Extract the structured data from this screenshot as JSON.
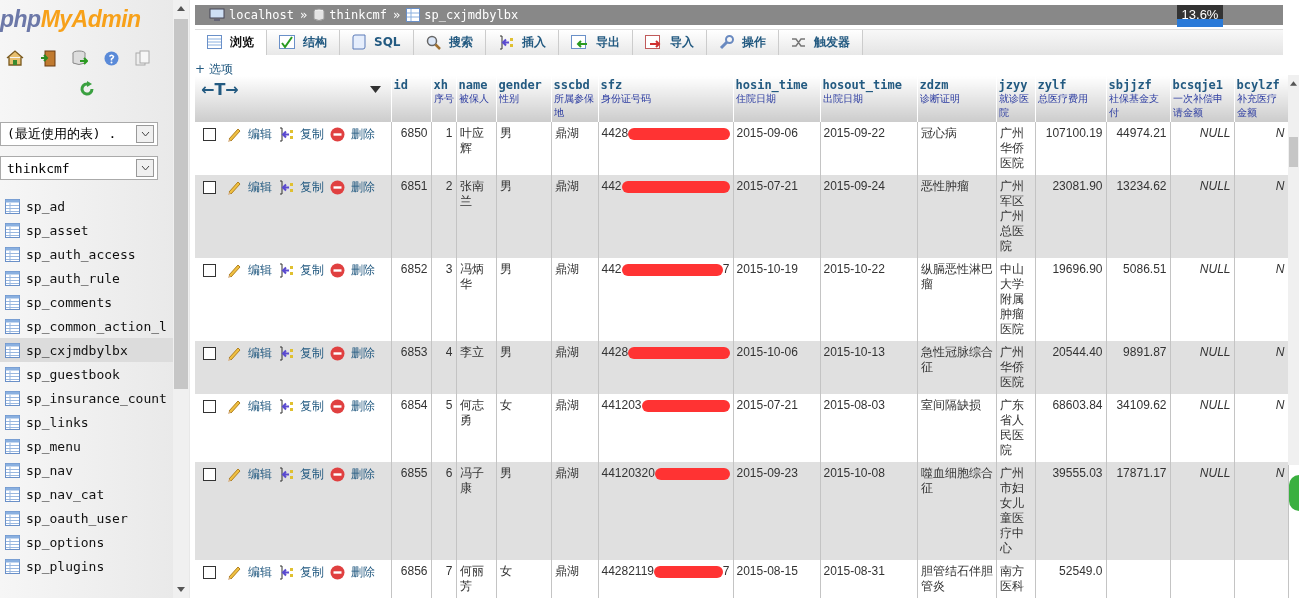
{
  "sidebar": {
    "logo": {
      "part1": "php",
      "part2": "MyAdmin"
    },
    "recent_select": "(最近使用的表) .",
    "db_select": "thinkcmf",
    "tables": [
      {
        "label": "sp_ad",
        "selected": false
      },
      {
        "label": "sp_asset",
        "selected": false
      },
      {
        "label": "sp_auth_access",
        "selected": false
      },
      {
        "label": "sp_auth_rule",
        "selected": false
      },
      {
        "label": "sp_comments",
        "selected": false
      },
      {
        "label": "sp_common_action_l",
        "selected": false
      },
      {
        "label": "sp_cxjmdbylbx",
        "selected": true
      },
      {
        "label": "sp_guestbook",
        "selected": false
      },
      {
        "label": "sp_insurance_count",
        "selected": false
      },
      {
        "label": "sp_links",
        "selected": false
      },
      {
        "label": "sp_menu",
        "selected": false
      },
      {
        "label": "sp_nav",
        "selected": false
      },
      {
        "label": "sp_nav_cat",
        "selected": false
      },
      {
        "label": "sp_oauth_user",
        "selected": false
      },
      {
        "label": "sp_options",
        "selected": false
      },
      {
        "label": "sp_plugins",
        "selected": false
      }
    ]
  },
  "breadcrumb": [
    {
      "kind": "server",
      "label": "localhost"
    },
    {
      "kind": "database",
      "label": "thinkcmf"
    },
    {
      "kind": "table",
      "label": "sp_cxjmdbylbx"
    }
  ],
  "breadcrumb_separator": "»",
  "overlay_badge": "13.6%",
  "tabs": [
    {
      "kind": "browse",
      "label": "浏览",
      "selected": true
    },
    {
      "kind": "structure",
      "label": "结构",
      "selected": false
    },
    {
      "kind": "sql",
      "label": "SQL",
      "selected": false
    },
    {
      "kind": "search",
      "label": "搜索",
      "selected": false
    },
    {
      "kind": "insert",
      "label": "插入",
      "selected": false
    },
    {
      "kind": "export",
      "label": "导出",
      "selected": false
    },
    {
      "kind": "import",
      "label": "导入",
      "selected": false
    },
    {
      "kind": "operations",
      "label": "操作",
      "selected": false
    },
    {
      "kind": "triggers",
      "label": "触发器",
      "selected": false
    }
  ],
  "options_link": "+ 选项",
  "table": {
    "resize_label": "←T→",
    "columns": [
      {
        "name": "id",
        "kind": "num"
      },
      {
        "name": "xh",
        "comment": "序号",
        "kind": "num"
      },
      {
        "name": "name",
        "comment": "被保人",
        "kind": "text"
      },
      {
        "name": "gender",
        "comment": "性别",
        "kind": "text"
      },
      {
        "name": "sscbd",
        "comment": "所属参保地",
        "kind": "text"
      },
      {
        "name": "sfz",
        "comment": "身份证号码",
        "kind": "redacted"
      },
      {
        "name": "hosin_time",
        "comment": "住院日期",
        "kind": "text"
      },
      {
        "name": "hosout_time",
        "comment": "出院日期",
        "kind": "text"
      },
      {
        "name": "zdzm",
        "comment": "诊断证明",
        "kind": "text"
      },
      {
        "name": "jzyy",
        "comment": "就诊医院",
        "kind": "text"
      },
      {
        "name": "zylf",
        "comment": "总医疗费用",
        "kind": "num"
      },
      {
        "name": "sbjjzf",
        "comment": "社保基金支付",
        "kind": "num"
      },
      {
        "name": "bcsqje1",
        "comment": "一次补偿申请金额",
        "kind": "null"
      },
      {
        "name": "bcylzf",
        "comment": "补充医疗金额",
        "kind": "null"
      }
    ],
    "rows": [
      {
        "checked": false,
        "actions": [
          "编辑",
          "复制",
          "删除"
        ],
        "sfz_tail": null,
        "cells": [
          "6850",
          "1",
          "叶应辉",
          "男",
          "鼎湖",
          "4428",
          "2015-09-06",
          "2015-09-22",
          "冠心病",
          "广州华侨医院",
          "107100.19",
          "44974.21",
          "NULL",
          "N"
        ]
      },
      {
        "checked": false,
        "actions": [
          "编辑",
          "复制",
          "删除"
        ],
        "sfz_tail": null,
        "cells": [
          "6851",
          "2",
          "张南兰",
          "男",
          "鼎湖",
          "442",
          "2015-07-21",
          "2015-09-24",
          "恶性肿瘤",
          "广州军区广州总医院",
          "23081.90",
          "13234.62",
          "NULL",
          "N"
        ]
      },
      {
        "checked": false,
        "actions": [
          "编辑",
          "复制",
          "删除"
        ],
        "sfz_tail": "7",
        "cells": [
          "6852",
          "3",
          "冯炳华",
          "男",
          "鼎湖",
          "442",
          "2015-10-19",
          "2015-10-22",
          "纵膈恶性淋巴瘤",
          "中山大学附属肿瘤医院",
          "19696.90",
          "5086.51",
          "NULL",
          "N"
        ]
      },
      {
        "checked": false,
        "actions": [
          "编辑",
          "复制",
          "删除"
        ],
        "sfz_tail": null,
        "cells": [
          "6853",
          "4",
          "李立",
          "男",
          "鼎湖",
          "4428",
          "2015-10-06",
          "2015-10-13",
          "急性冠脉综合征",
          "广州华侨医院",
          "20544.40",
          "9891.87",
          "NULL",
          "N"
        ]
      },
      {
        "checked": false,
        "actions": [
          "编辑",
          "复制",
          "删除"
        ],
        "sfz_tail": null,
        "cells": [
          "6854",
          "5",
          "何志勇",
          "女",
          "鼎湖",
          "441203",
          "2015-07-21",
          "2015-08-03",
          "室间隔缺损",
          "广东省人民医院",
          "68603.84",
          "34109.62",
          "NULL",
          "N"
        ]
      },
      {
        "checked": false,
        "actions": [
          "编辑",
          "复制",
          "删除"
        ],
        "sfz_tail": null,
        "cells": [
          "6855",
          "6",
          "冯子康",
          "男",
          "鼎湖",
          "44120320",
          "2015-09-23",
          "2015-10-08",
          "噬血细胞综合征",
          "广州市妇女儿童医疗中心",
          "39555.03",
          "17871.17",
          "NULL",
          "N"
        ]
      },
      {
        "checked": false,
        "actions": [
          "编辑",
          "复制",
          "删除"
        ],
        "sfz_tail": "7",
        "cells": [
          "6856",
          "7",
          "何丽芳",
          "女",
          "鼎湖",
          "44282119",
          "2015-08-15",
          "2015-08-31",
          "胆管结石伴胆管炎",
          "南方医科",
          "52549.0",
          null,
          null,
          null
        ]
      }
    ]
  }
}
